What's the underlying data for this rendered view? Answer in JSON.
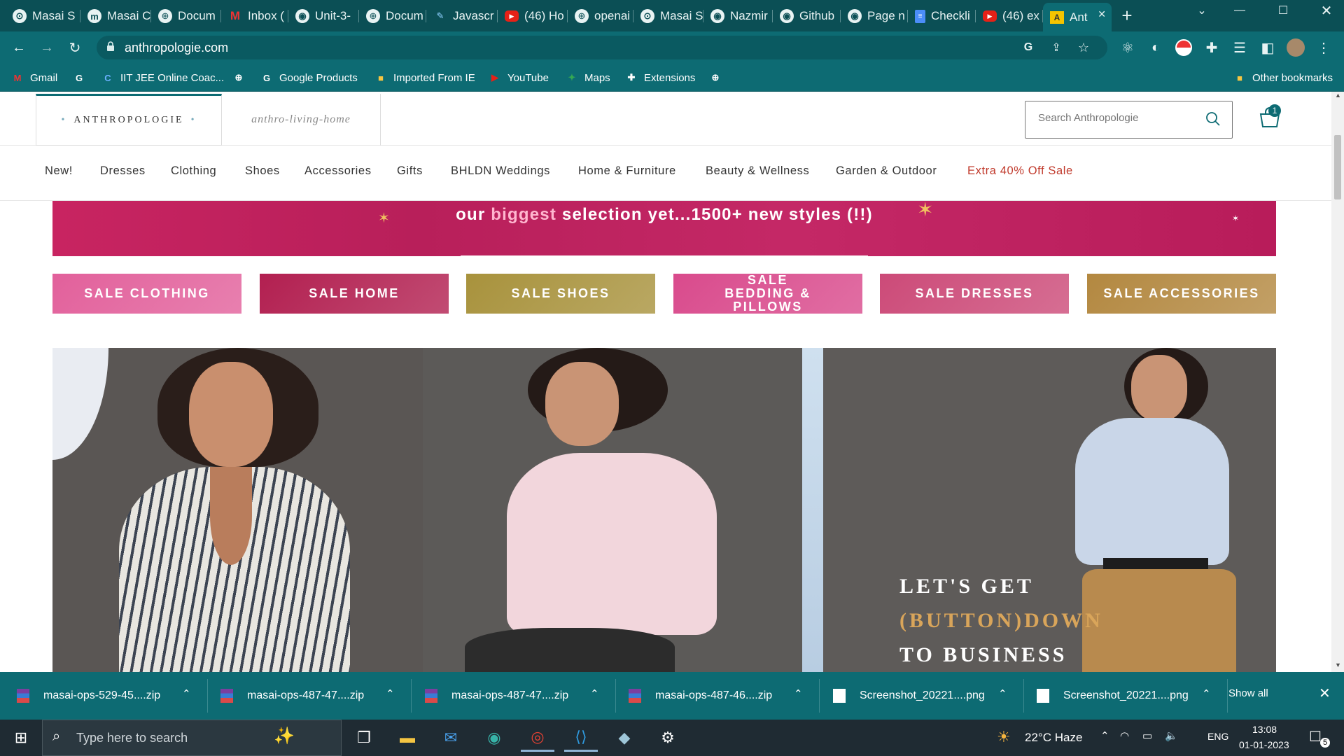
{
  "browser": {
    "tabs": [
      {
        "title": "Masai S",
        "icon": "ms"
      },
      {
        "title": "Masai C",
        "icon": "m"
      },
      {
        "title": "Docum",
        "icon": "globe"
      },
      {
        "title": "Inbox (",
        "icon": "gmail"
      },
      {
        "title": "Unit-3-",
        "icon": "github"
      },
      {
        "title": "Docum",
        "icon": "globe"
      },
      {
        "title": "Javascr",
        "icon": "feather"
      },
      {
        "title": "(46) Ho",
        "icon": "youtube"
      },
      {
        "title": "openai",
        "icon": "globe"
      },
      {
        "title": "Masai S",
        "icon": "ms"
      },
      {
        "title": "Nazmir",
        "icon": "github"
      },
      {
        "title": "Github",
        "icon": "github"
      },
      {
        "title": "Page n",
        "icon": "github"
      },
      {
        "title": "Checkli",
        "icon": "docs"
      },
      {
        "title": "(46) ex",
        "icon": "youtube"
      },
      {
        "title": "Ant",
        "icon": "anthropologie",
        "active": true
      }
    ],
    "url": "anthropologie.com",
    "bookmarks": [
      {
        "label": "Gmail",
        "icon": "gmail"
      },
      {
        "label": "",
        "icon": "google"
      },
      {
        "label": "IIT JEE Online Coac...",
        "icon": "c"
      },
      {
        "label": "",
        "icon": "globe"
      },
      {
        "label": "Google Products",
        "icon": "google"
      },
      {
        "label": "Imported From IE",
        "icon": "folder"
      },
      {
        "label": "YouTube",
        "icon": "youtube"
      },
      {
        "label": "Maps",
        "icon": "maps"
      },
      {
        "label": "Extensions",
        "icon": "puzzle"
      },
      {
        "label": "",
        "icon": "globe"
      }
    ],
    "other_bookmarks": "Other bookmarks"
  },
  "site": {
    "logo_main": "ANTHROPOLOGIE",
    "logo_home": "anthro-living-home",
    "search_placeholder": "Search Anthropologie",
    "cart_count": "1",
    "nav": [
      "New!",
      "Dresses",
      "Clothing",
      "Shoes",
      "Accessories",
      "Gifts",
      "BHLDN Weddings",
      "Home & Furniture",
      "Beauty & Wellness",
      "Garden & Outdoor",
      "Extra 40% Off Sale"
    ],
    "banner": {
      "pre": "our ",
      "highlight": "biggest",
      "post": " selection yet...1500+ new styles (!!)"
    },
    "tiles": [
      {
        "label": "SALE CLOTHING",
        "color": "#e2609b"
      },
      {
        "label": "SALE HOME",
        "color": "#b21f50"
      },
      {
        "label": "SALE SHOES",
        "color": "#a8923c"
      },
      {
        "label": "SALE BEDDING & PILLOWS",
        "color": "#d94a8c"
      },
      {
        "label": "SALE DRESSES",
        "color": "#cc4a78"
      },
      {
        "label": "SALE ACCESSORIES",
        "color": "#b38840"
      }
    ],
    "hero": {
      "line1": "LET'S GET",
      "line2": "(BUTTON)DOWN",
      "line3": "TO BUSINESS"
    }
  },
  "downloads": [
    {
      "name": "masai-ops-529-45....zip",
      "icon": "archive"
    },
    {
      "name": "masai-ops-487-47....zip",
      "icon": "archive"
    },
    {
      "name": "masai-ops-487-47....zip",
      "icon": "archive"
    },
    {
      "name": "masai-ops-487-46....zip",
      "icon": "archive"
    },
    {
      "name": "Screenshot_20221....png",
      "icon": "file"
    },
    {
      "name": "Screenshot_20221....png",
      "icon": "file"
    }
  ],
  "downloads_show_all": "Show all",
  "taskbar": {
    "search_placeholder": "Type here to search",
    "weather": "22°C  Haze",
    "lang": "ENG",
    "time": "13:08",
    "date": "01-01-2023",
    "notifications": "5"
  },
  "colors": {
    "brand": "#0d6b73",
    "sale": "#c0392b",
    "banner": "#c42866"
  }
}
